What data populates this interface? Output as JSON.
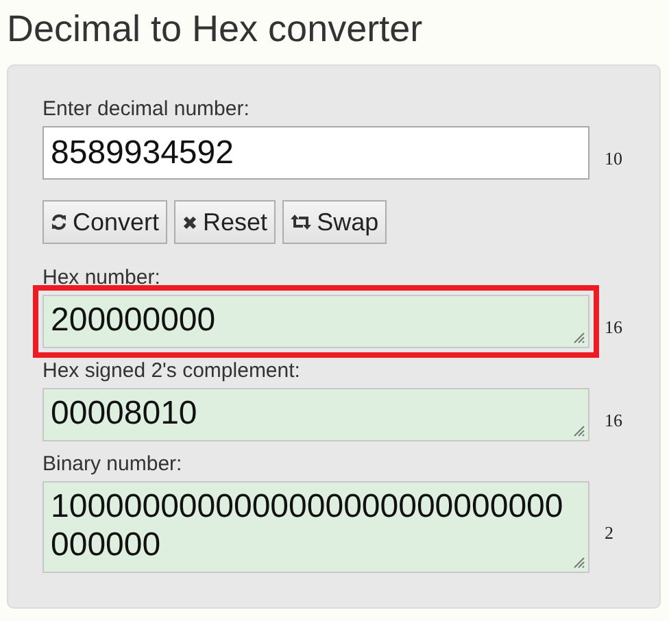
{
  "title": "Decimal to Hex converter",
  "input": {
    "label": "Enter decimal number:",
    "value": "8589934592",
    "base": "10"
  },
  "buttons": [
    {
      "label": "Convert",
      "kind": "convert"
    },
    {
      "label": "Reset",
      "kind": "reset"
    },
    {
      "label": "Swap",
      "kind": "swap"
    }
  ],
  "outputs": [
    {
      "label": "Hex number:",
      "value": "200000000",
      "base": "16",
      "highlighted": true
    },
    {
      "label": "Hex signed 2's complement:",
      "value": "00008010",
      "base": "16",
      "highlighted": false
    },
    {
      "label": "Binary number:",
      "value": "1000000000000000000000000000000000",
      "base": "2",
      "highlighted": false
    }
  ]
}
